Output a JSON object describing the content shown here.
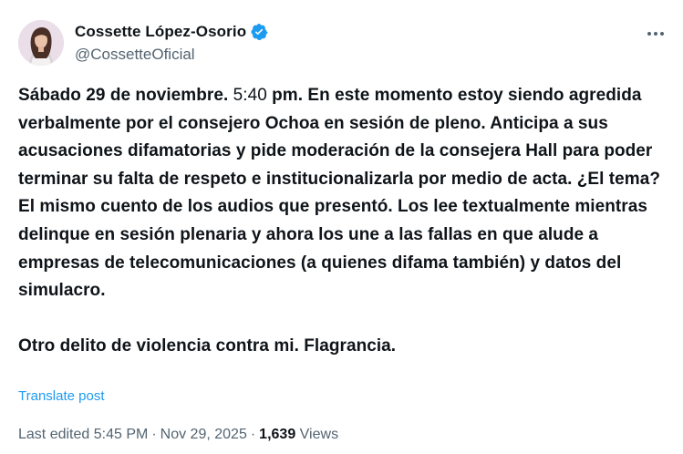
{
  "author": {
    "display_name": "Cossette López-Osorio",
    "handle": "@CossetteOficial",
    "verified": true,
    "avatar_icon": "profile-photo",
    "verified_color": "#1d9bf0"
  },
  "post": {
    "lead_bold": "Sábado 29 de noviembre. ",
    "time_plain": "5:40",
    "body_rest": " pm. En este momento estoy siendo agredida verbalmente por el consejero Ochoa en sesión de pleno. Anticipa a sus acusaciones difamatorias  y pide moderación de la consejera Hall para poder terminar su falta de respeto e institucionalizarla por medio de acta. ¿El tema? El mismo cuento de los audios que presentó. Los lee textualmente mientras delinque en sesión plenaria y ahora los une a las fallas en que alude a empresas de telecomunicaciones (a quienes difama también) y datos del simulacro.",
    "closing": "Otro delito de violencia contra mi. Flagrancia."
  },
  "actions": {
    "translate_label": "Translate post",
    "more_icon": "more-horizontal-icon"
  },
  "meta": {
    "edited_label": "Last edited",
    "time": "5:45 PM",
    "separator": "·",
    "date": "Nov 29, 2025",
    "views_count": "1,639",
    "views_label": "Views"
  }
}
